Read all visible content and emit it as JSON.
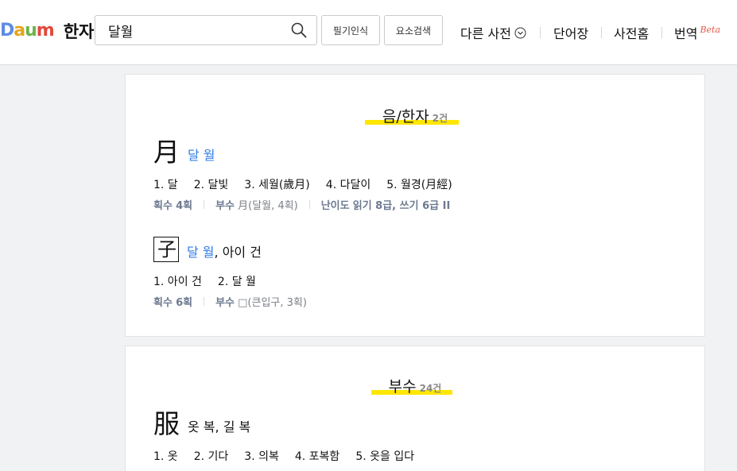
{
  "header": {
    "logo_text": "Daum",
    "logo_title": "한자",
    "search_value": "달월",
    "handwriting_button": "필기인식",
    "element_search_button": "요소검색",
    "other_dict": "다른 사전",
    "wordbook": "단어장",
    "dict_home": "사전홈",
    "translate": "번역",
    "beta": "Beta"
  },
  "section1": {
    "title": "음/한자",
    "count": "2건",
    "entries": [
      {
        "hanja": "月",
        "reading_link": "달 월",
        "reading_rest": "",
        "meanings": [
          "1. 달",
          "2. 달빛",
          "3. 세월(歲月)",
          "4. 다달이",
          "5. 월경(月經)"
        ],
        "strokes_label": "획수",
        "strokes_value": "4획",
        "radical_label": "부수",
        "radical_value": "月(달월, 4획)",
        "level_label": "난이도",
        "level_value": "읽기 8급, 쓰기 6급 II"
      },
      {
        "hanja": "子",
        "reading_link": "달 월",
        "reading_rest": ", 아이 건",
        "meanings": [
          "1. 아이 건",
          "2. 달 월"
        ],
        "strokes_label": "획수",
        "strokes_value": "6획",
        "radical_label": "부수",
        "radical_value": "□(큰입구, 3획)"
      }
    ]
  },
  "section2": {
    "title": "부수",
    "count": "24건",
    "entries": [
      {
        "hanja": "服",
        "reading": "옷 복, 길 복",
        "meanings": [
          "1. 옷",
          "2. 기다",
          "3. 의복",
          "4. 포복함",
          "5. 옷을 입다"
        ]
      }
    ]
  }
}
